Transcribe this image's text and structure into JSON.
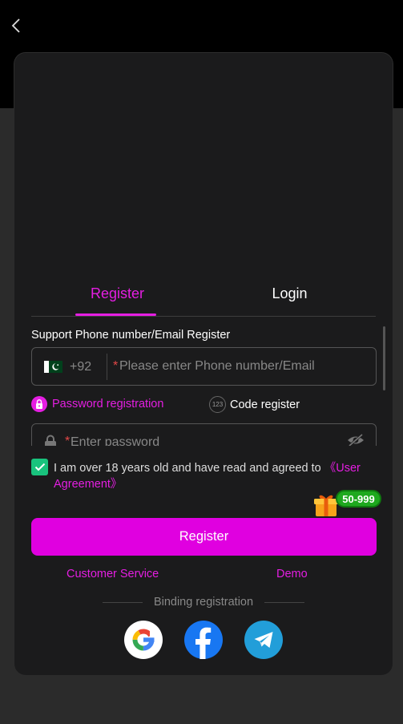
{
  "tabs": {
    "register": "Register",
    "login": "Login"
  },
  "support_label": "Support Phone number/Email Register",
  "phone": {
    "country_code": "+92",
    "required_mark": "*",
    "placeholder": "Please enter Phone number/Email"
  },
  "modes": {
    "password": "Password registration",
    "code": "Code register"
  },
  "password": {
    "required_mark": "*",
    "placeholder": "Enter password"
  },
  "agreement": {
    "text": "I am over 18 years old and have read and agreed to ",
    "link": "《User Agreement》",
    "checked": true
  },
  "promo": {
    "badge": "50-999"
  },
  "register_button": "Register",
  "links": {
    "customer_service": "Customer Service",
    "demo": "Demo"
  },
  "binding_label": "Binding registration",
  "social": [
    "google-icon",
    "facebook-icon",
    "telegram-icon"
  ],
  "colors": {
    "accent": "#e51ee2",
    "button": "#e000e0",
    "check": "#19c37d",
    "badge": "#1ea91e"
  }
}
